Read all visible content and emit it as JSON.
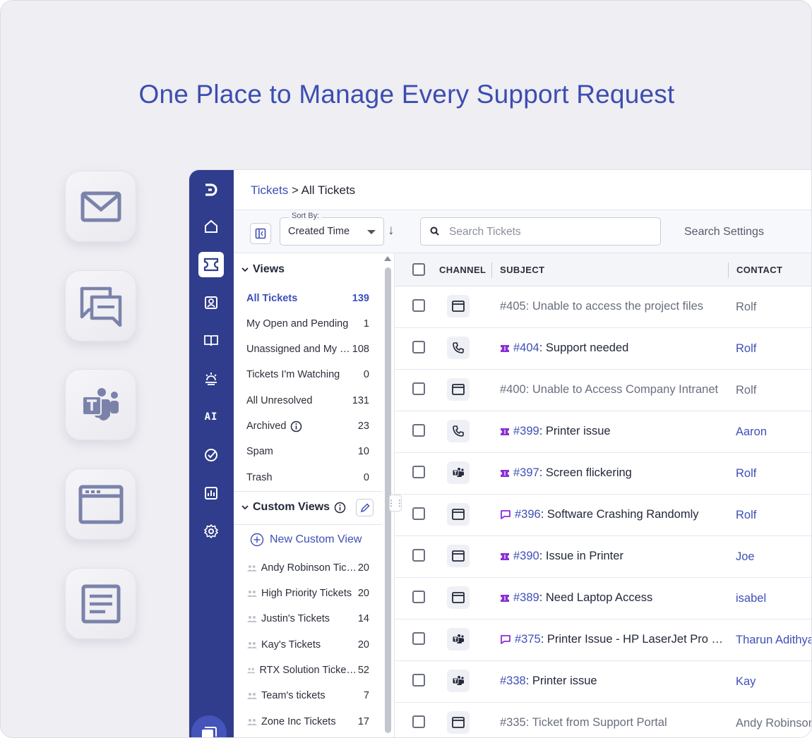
{
  "hero": {
    "title": "One Place to Manage Every Support Request"
  },
  "channel_tiles": [
    "mail-icon",
    "chat-icon",
    "teams-icon",
    "web-form-icon",
    "document-icon"
  ],
  "nav_rail": {
    "items": [
      "logo",
      "home",
      "tickets",
      "contacts",
      "knowledge-base",
      "community",
      "AI",
      "tasks",
      "reports",
      "settings"
    ],
    "ai_label": "AI",
    "active": "tickets"
  },
  "breadcrumb": {
    "parent": "Tickets",
    "separator": " > ",
    "current": "All Tickets"
  },
  "toolbar": {
    "sort_legend": "Sort By:",
    "sort_value": "Created Time",
    "sort_direction": "↓",
    "search_placeholder": "Search Tickets",
    "search_settings": "Search Settings"
  },
  "views": {
    "heading": "Views",
    "items": [
      {
        "label": "All Tickets",
        "count": "139"
      },
      {
        "label": "My Open and Pending",
        "count": "1"
      },
      {
        "label": "Unassigned and My …",
        "count": "108"
      },
      {
        "label": "Tickets I'm Watching",
        "count": "0"
      },
      {
        "label": "All Unresolved",
        "count": "131"
      },
      {
        "label": "Archived",
        "count": "23"
      },
      {
        "label": "Spam",
        "count": "10"
      },
      {
        "label": "Trash",
        "count": "0"
      }
    ]
  },
  "custom_views": {
    "heading": "Custom Views",
    "new_label": "New Custom View",
    "items": [
      {
        "label": "Andy Robinson Tic…",
        "count": "20"
      },
      {
        "label": "High Priority Tickets",
        "count": "20"
      },
      {
        "label": "Justin's Tickets",
        "count": "14"
      },
      {
        "label": "Kay's Tickets",
        "count": "20"
      },
      {
        "label": "RTX Solution Ticke…",
        "count": "52"
      },
      {
        "label": "Team's tickets",
        "count": "7"
      },
      {
        "label": "Zone Inc Tickets",
        "count": "17"
      }
    ]
  },
  "table": {
    "columns": {
      "channel": "CHANNEL",
      "subject": "SUBJECT",
      "contact": "CONTACT"
    },
    "rows": [
      {
        "channel": "web",
        "tid": "#405",
        "title": ": Unable to access the project files",
        "contact": "Rolf",
        "unread": false,
        "tag": ""
      },
      {
        "channel": "phone",
        "tid": "#404",
        "title": ": Support needed",
        "contact": "Rolf",
        "unread": true,
        "tag": "ticket"
      },
      {
        "channel": "web",
        "tid": "#400",
        "title": ": Unable to Access Company Intranet",
        "contact": "Rolf",
        "unread": false,
        "tag": ""
      },
      {
        "channel": "phone",
        "tid": "#399",
        "title": ": Printer issue",
        "contact": "Aaron",
        "unread": true,
        "tag": "ticket"
      },
      {
        "channel": "teams",
        "tid": "#397",
        "title": ": Screen flickering",
        "contact": "Rolf",
        "unread": true,
        "tag": "ticket"
      },
      {
        "channel": "web",
        "tid": "#396",
        "title": ": Software Crashing Randomly",
        "contact": "Rolf",
        "unread": true,
        "tag": "comment"
      },
      {
        "channel": "web",
        "tid": "#390",
        "title": ": Issue in Printer",
        "contact": "Joe",
        "unread": true,
        "tag": "ticket"
      },
      {
        "channel": "web",
        "tid": "#389",
        "title": ": Need Laptop Access",
        "contact": "isabel",
        "unread": true,
        "tag": "ticket"
      },
      {
        "channel": "teams",
        "tid": "#375",
        "title": ": Printer Issue - HP LaserJet Pro …",
        "contact": "Tharun Adithya",
        "unread": true,
        "tag": "comment"
      },
      {
        "channel": "teams",
        "tid": "#338",
        "title": ": Printer issue",
        "contact": "Kay",
        "unread": true,
        "tag": ""
      },
      {
        "channel": "web",
        "tid": "#335",
        "title": ": Ticket from Support Portal",
        "contact": "Andy Robinson",
        "unread": false,
        "tag": ""
      }
    ]
  },
  "colors": {
    "brand": "#3d4db0",
    "rail": "#303d8c",
    "tag": "#8b2fd6"
  }
}
